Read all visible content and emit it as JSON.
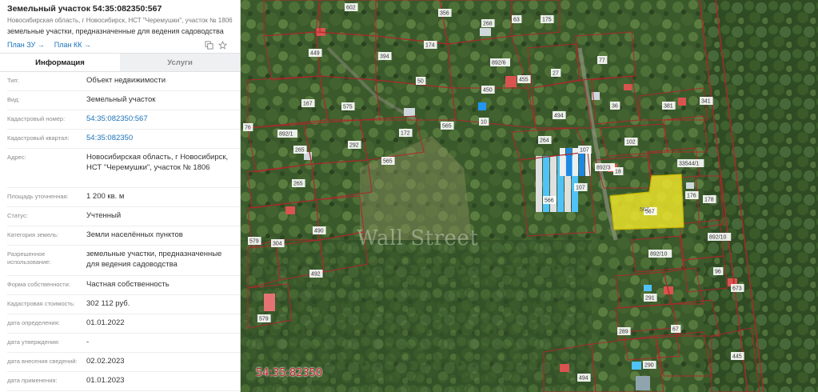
{
  "panel": {
    "title": "Земельный участок 54:35:082350:567",
    "subtitle": "Новосибирская область, г Новосибирск, НСТ \"Черемушки\", участок № 1806",
    "purpose": "земельные участки, предназначенные для ведения садоводства",
    "plan_zu": "План ЗУ →",
    "plan_kk": "План КК →",
    "tools": [
      "copy-icon",
      "star-icon"
    ]
  },
  "tabs": [
    {
      "label": "Информация",
      "active": true
    },
    {
      "label": "Услуги",
      "active": false
    }
  ],
  "info": [
    {
      "label": "Тип:",
      "value": "Объект недвижимости",
      "link": false
    },
    {
      "label": "Вид:",
      "value": "Земельный участок",
      "link": false
    },
    {
      "label": "Кадастровый номер:",
      "value": "54:35:082350:567",
      "link": true
    },
    {
      "label": "Кадастровый квартал:",
      "value": "54:35:082350",
      "link": true
    },
    {
      "label": "Адрес:",
      "value": "Новосибирская область, г Новосибирск, НСТ \"Черемушки\", участок № 1806",
      "link": false
    },
    {
      "label": "Площадь уточненная:",
      "value": "1 200 кв. м",
      "link": false
    },
    {
      "label": "Статус:",
      "value": "Учтенный",
      "link": false
    },
    {
      "label": "Категория земель:",
      "value": "Земли населённых пунктов",
      "link": false
    },
    {
      "label": "Разрешенное использование:",
      "value": "земельные участки, предназначенные для ведения садоводства",
      "link": false
    },
    {
      "label": "Форма собственности:",
      "value": "Частная собственность",
      "link": false
    },
    {
      "label": "Кадастровая стоимость:",
      "value": "302 112 руб.",
      "link": false
    },
    {
      "label": "дата определения:",
      "value": "01.01.2022",
      "link": false
    },
    {
      "label": "дата утверждения:",
      "value": "-",
      "link": false
    },
    {
      "label": "дата внесения сведений:",
      "value": "02.02.2023",
      "link": false
    },
    {
      "label": "дата применения:",
      "value": "01.01.2023",
      "link": false
    }
  ],
  "map": {
    "quarter_label": "54:35:82350",
    "watermark": "Wall Street",
    "selected_parcel": "567",
    "highlight_color": "#f5ea2a",
    "boundary_color": "#b0262a",
    "parcel_numbers": [
      "602",
      "356",
      "268",
      "63",
      "175",
      "449",
      "394",
      "174",
      "892/6",
      "77",
      "455",
      "27",
      "167",
      "575",
      "50",
      "450",
      "36",
      "381",
      "341",
      "76",
      "892/1",
      "10",
      "494",
      "565",
      "172",
      "264",
      "107",
      "102",
      "292",
      "265",
      "565",
      "892/3",
      "18",
      "33544/1",
      "178",
      "566",
      "107",
      "176",
      "265",
      "567",
      "892/10",
      "490",
      "579",
      "304",
      "892/10",
      "492",
      "96",
      "291",
      "673",
      "289",
      "67",
      "579",
      "290",
      "494",
      "445"
    ]
  }
}
